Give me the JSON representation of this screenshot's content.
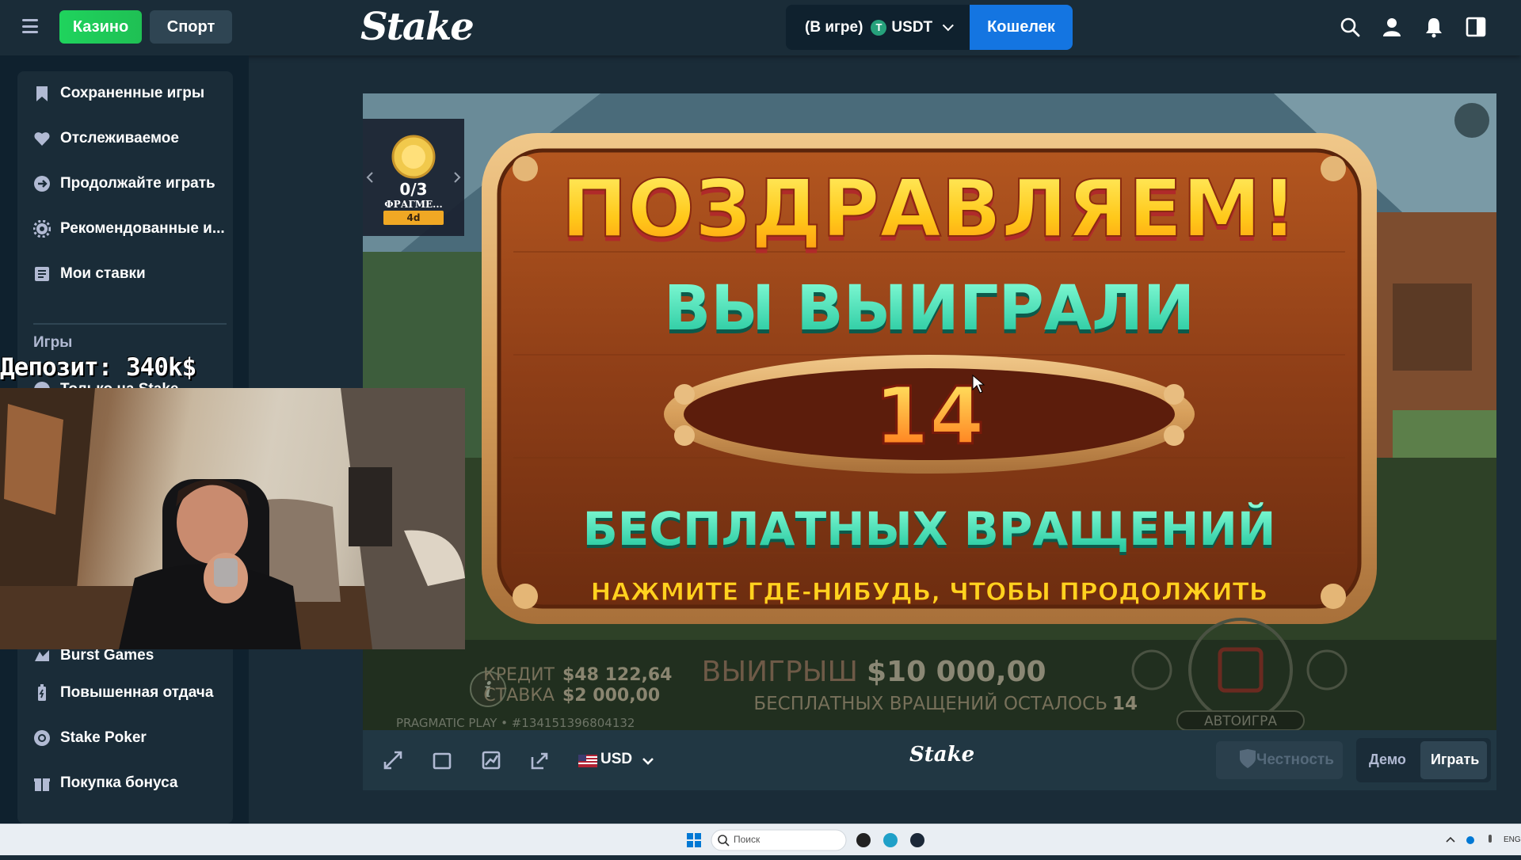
{
  "header": {
    "casino_label": "Казино",
    "sport_label": "Спорт",
    "logo_text": "Stake",
    "balance_label": "(В игре)",
    "currency": "USDT",
    "currency_coin_letter": "T",
    "wallet_label": "Кошелек"
  },
  "sidebar": {
    "items": [
      {
        "label": "Сохраненные игры",
        "icon": "bookmark-icon"
      },
      {
        "label": "Отслеживаемое",
        "icon": "heart-icon"
      },
      {
        "label": "Продолжайте играть",
        "icon": "arrow-circle-icon"
      },
      {
        "label": "Рекомендованные и...",
        "icon": "gear-icon"
      },
      {
        "label": "Мои ставки",
        "icon": "list-icon"
      }
    ],
    "games_header": "Игры",
    "games_items": [
      {
        "label": "Только на Stake",
        "icon": "star-icon"
      },
      {
        "label": "Burst Games",
        "icon": "burst-icon"
      },
      {
        "label": "Повышенная отдача",
        "icon": "battery-icon"
      },
      {
        "label": "Stake Poker",
        "icon": "poker-chip-icon"
      },
      {
        "label": "Покупка бонуса",
        "icon": "gift-icon"
      }
    ]
  },
  "overlay": {
    "deposit_text": "Депозит: 340k$"
  },
  "game": {
    "fragments_count": "0/3",
    "fragments_label": "ФРАГМЕ...",
    "fragments_timer": "4d",
    "congrats": "ПОЗДРАВЛЯЕМ!",
    "you_won": "ВЫ ВЫИГРАЛИ",
    "spins_count": "14",
    "free_spins": "БЕСПЛАТНЫХ ВРАЩЕНИЙ",
    "click_continue": "НАЖМИТЕ ГДЕ-НИБУДЬ, ЧТОБЫ ПРОДОЛЖИТЬ",
    "credit_label": "КРЕДИТ",
    "credit_value": "$48 122,64",
    "bet_label": "СТАВКА",
    "bet_value": "$2 000,00",
    "win_label": "ВЫИГРЫШ",
    "win_value": "$10 000,00",
    "spins_left_label": "БЕСПЛАТНЫХ ВРАЩЕНИЙ ОСТАЛОСЬ",
    "spins_left_value": "14",
    "autoplay_label": "АВТОИГРА",
    "provider_id": "PRAGMATIC PLAY • #134151396804132"
  },
  "game_bar": {
    "currency": "USD",
    "logo_text": "Stake",
    "fairness_label": "Честность",
    "demo_label": "Демо",
    "play_label": "Играть"
  },
  "taskbar": {
    "search_placeholder": "Поиск",
    "lang": "ENG"
  },
  "colors": {
    "bg": "#1a2c38",
    "sidebar": "#0f212e",
    "casino_green": "#1fd35d",
    "wallet_blue": "#1475e1",
    "congrats_yellow": "#ffd21f",
    "won_green": "#3ee6b8"
  }
}
